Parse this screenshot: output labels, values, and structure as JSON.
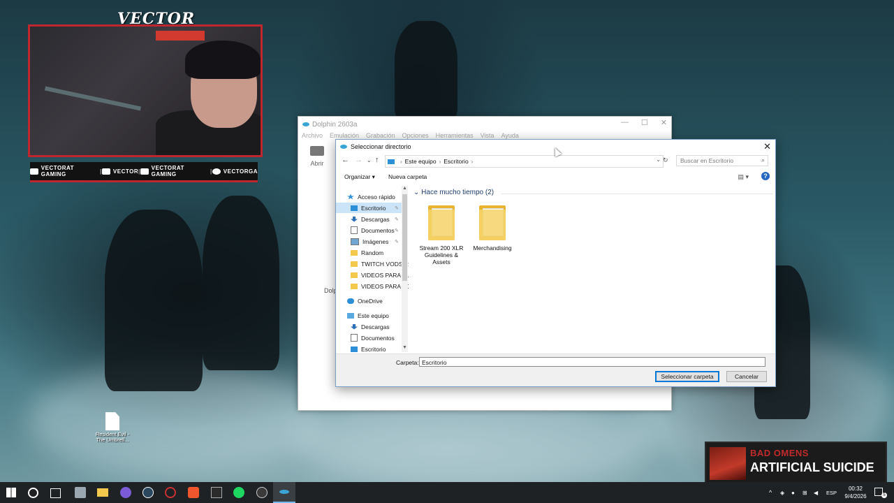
{
  "overlay": {
    "cam_title": "VECTOR",
    "socials": [
      {
        "icon": "youtube-icon",
        "label": "VECTORAT GAMING"
      },
      {
        "icon": "twitch-icon",
        "label": "VECTOR"
      },
      {
        "icon": "twitter-icon",
        "label": "VECTORAT GAMING"
      },
      {
        "icon": "instagram-icon",
        "label": "VECTORGA"
      }
    ],
    "now_playing": {
      "artist": "BAD OMENS",
      "song": "ARTIFICIAL SUICIDE"
    }
  },
  "dolphin": {
    "title": "Dolphin 2603a",
    "menu": [
      "Archivo",
      "Emulación",
      "Grabación",
      "Opciones",
      "Herramientas",
      "Vista",
      "Ayuda"
    ],
    "open_label": "Abrir",
    "side_label": "Dolp"
  },
  "dialog": {
    "title": "Seleccionar directorio",
    "breadcrumb": [
      "Este equipo",
      "Escritorio"
    ],
    "search_placeholder": "Buscar en Escritorio",
    "organize_label": "Organizar ▾",
    "new_folder_label": "Nueva carpeta",
    "nav_items": [
      {
        "label": "Acceso rápido",
        "icon": "star-icon",
        "pinned": false
      },
      {
        "label": "Escritorio",
        "icon": "desktop-icon",
        "pinned": true,
        "selected": true
      },
      {
        "label": "Descargas",
        "icon": "download-icon",
        "pinned": true
      },
      {
        "label": "Documentos",
        "icon": "document-icon",
        "pinned": true
      },
      {
        "label": "Imágenes",
        "icon": "image-icon",
        "pinned": true
      },
      {
        "label": "Random",
        "icon": "folder-icon",
        "pinned": false
      },
      {
        "label": "TWITCH VODS R",
        "icon": "folder-icon",
        "pinned": false
      },
      {
        "label": "VIDEOS PARA SU",
        "icon": "folder-icon",
        "pinned": false
      },
      {
        "label": "VIDEOS PARA YC",
        "icon": "folder-icon",
        "pinned": false
      },
      {
        "label": "OneDrive",
        "icon": "cloud-icon",
        "pinned": false
      },
      {
        "label": "Este equipo",
        "icon": "computer-icon",
        "pinned": false
      },
      {
        "label": "Descargas",
        "icon": "download-icon",
        "pinned": false
      },
      {
        "label": "Documentos",
        "icon": "document-icon",
        "pinned": false
      },
      {
        "label": "Escritorio",
        "icon": "desktop-icon",
        "pinned": false
      }
    ],
    "group_header": "Hace mucho tiempo (2)",
    "files": [
      {
        "name": "Stream 200 XLR Guidelines & Assets",
        "icon": "folder-icon"
      },
      {
        "name": "Merchandising",
        "icon": "folder-icon"
      }
    ],
    "folder_label": "Carpeta:",
    "folder_value": "Escritorio",
    "select_button": "Seleccionar carpeta",
    "cancel_button": "Cancelar"
  },
  "desktop_icon": {
    "label": "Resident Evil - The Umbrell..."
  },
  "taskbar": {
    "language": "ESP",
    "time": "00:32",
    "date": "9/4/2026",
    "notification_count": "5"
  },
  "colors": {
    "accent": "#c0262e",
    "selection": "#cce4f7",
    "taskbar": "#1f2225"
  }
}
